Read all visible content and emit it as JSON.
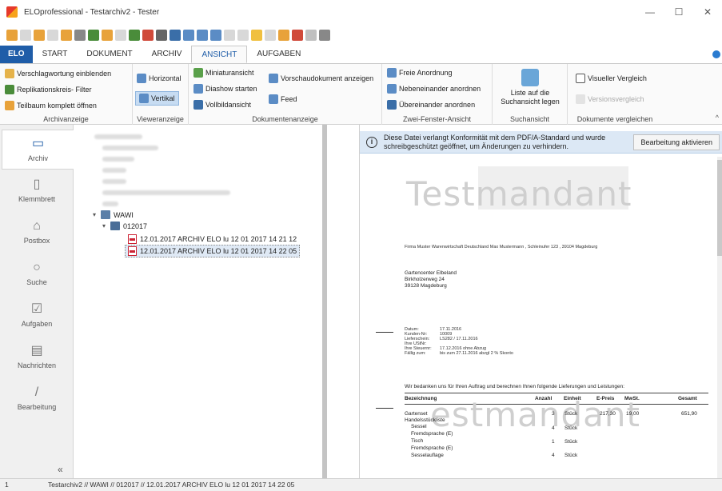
{
  "window": {
    "title": "ELOprofessional - Testarchiv2 - Tester",
    "controls": [
      "—",
      "☐",
      "✕"
    ]
  },
  "quick_access_icons": [
    "back-icon",
    "forward-icon",
    "up-icon",
    "refresh-icon",
    "stamp-icon",
    "search-icon",
    "tree-icon",
    "checkout-icon",
    "new-doc-icon",
    "save-icon",
    "edit-icon",
    "print-icon",
    "disk-icon",
    "grid-icon",
    "image-icon",
    "layout-icon",
    "page-icon",
    "copy-icon",
    "folder-icon",
    "delete-icon",
    "mail-icon",
    "calendar-icon",
    "undo-icon",
    "more-icon"
  ],
  "tabs": [
    {
      "label": "ELO"
    },
    {
      "label": "START"
    },
    {
      "label": "DOKUMENT"
    },
    {
      "label": "ARCHIV"
    },
    {
      "label": "ANSICHT"
    },
    {
      "label": "AUFGABEN"
    }
  ],
  "ribbon": {
    "archivanzeige": {
      "label": "Archivanzeige",
      "items": [
        "Verschlagwortung einblenden",
        "Replikationskreis- Filter",
        "Teilbaum komplett öffnen"
      ]
    },
    "vieweranzeige": {
      "label": "Vieweranzeige",
      "items": [
        "Horizontal",
        "Vertikal"
      ]
    },
    "dokumentenanzeige": {
      "label": "Dokumentenanzeige",
      "items": [
        "Miniaturansicht",
        "Diashow starten",
        "Vollbildansicht",
        "Vorschaudokument anzeigen",
        "Feed"
      ]
    },
    "zwei_fenster": {
      "label": "Zwei-Fenster-Ansicht",
      "items": [
        "Freie Anordnung",
        "Nebeneinander anordnen",
        "Übereinander anordnen"
      ]
    },
    "suchansicht": {
      "label": "Suchansicht",
      "big_button": "Liste auf die Suchansicht legen"
    },
    "vergleichen": {
      "label": "Dokumente vergleichen",
      "items": [
        "Visueller Vergleich",
        "Versionsvergleich"
      ]
    }
  },
  "nav": [
    {
      "label": "Archiv",
      "icon": "▭"
    },
    {
      "label": "Klemmbrett",
      "icon": "▯"
    },
    {
      "label": "Postbox",
      "icon": "⌂"
    },
    {
      "label": "Suche",
      "icon": "○"
    },
    {
      "label": "Aufgaben",
      "icon": "☑"
    },
    {
      "label": "Nachrichten",
      "icon": "▤"
    },
    {
      "label": "Bearbeitung",
      "icon": "/"
    }
  ],
  "nav_collapse": "«",
  "tree": {
    "wawi": "WAWI",
    "folder": "012017",
    "doc1": "12.01.2017  ARCHIV ELO lu 12 01 2017 14 21 12",
    "doc2": "12.01.2017  ARCHIV ELO lu 12 01 2017 14 22 05"
  },
  "infobar": {
    "text": "Diese Datei verlangt Konformität mit dem PDF/A-Standard und wurde schreibgeschützt geöffnet, um Änderungen zu verhindern.",
    "button": "Bearbeitung aktivieren"
  },
  "document": {
    "watermark": "Testmandant",
    "watermark_lower": "estmandant",
    "sender": "Firma  Muster Warenwirtschaft Deutschland Max Mustermann , Schleinufer 123 , 39104 Magdeburg",
    "recipient": [
      "Gartencenter Elbeland",
      "Birkholzerweg 24",
      "39128 Magdeburg"
    ],
    "meta_labels": [
      "Datum:",
      "Kunden-Nr:",
      "Lieferschein:",
      "Ihre UStNr:",
      "Ihre Steuernr:",
      "Fällig zum:"
    ],
    "meta_values": [
      "17.11.2016",
      "10009",
      "LS282 / 17.11.2016",
      "",
      "",
      "17.12.2016 ohne Abzug",
      "bis zum 27.11.2016 abzgl 2 % Skonto"
    ],
    "intro": "Wir bedanken uns für Ihren Auftrag und berechnen Ihnen folgende Lieferungen und Leistungen:",
    "table_headers": [
      "Bezeichnung",
      "Anzahl",
      "Einheit",
      "E-Preis",
      "MwSt.",
      "Gesamt"
    ],
    "rows": [
      {
        "name": "Gartenset",
        "qty": "3",
        "unit": "Stück",
        "price": "217,30",
        "vat": "19,00",
        "total": "651,90"
      },
      {
        "name": "Handelsstückliste",
        "qty": "",
        "unit": "",
        "price": "",
        "vat": "",
        "total": ""
      },
      {
        "name": "Sessel",
        "qty": "4",
        "unit": "Stück",
        "price": "",
        "vat": "",
        "total": ""
      },
      {
        "name": "Fremdsprache (E)",
        "qty": "",
        "unit": "",
        "price": "",
        "vat": "",
        "total": ""
      },
      {
        "name": "Tisch",
        "qty": "1",
        "unit": "Stück",
        "price": "",
        "vat": "",
        "total": ""
      },
      {
        "name": "Fremdsprache (E)",
        "qty": "",
        "unit": "",
        "price": "",
        "vat": "",
        "total": ""
      },
      {
        "name": "Sesselauflage",
        "qty": "4",
        "unit": "Stück",
        "price": "",
        "vat": "",
        "total": ""
      }
    ]
  },
  "statusbar": {
    "number": "1",
    "path": "Testarchiv2 // WAWI // 012017 // 12.01.2017  ARCHIV ELO lu 12 01 2017 14 22 05"
  },
  "colors": {
    "accent": "#1f5da8",
    "infobar_bg": "#dce8f5"
  }
}
